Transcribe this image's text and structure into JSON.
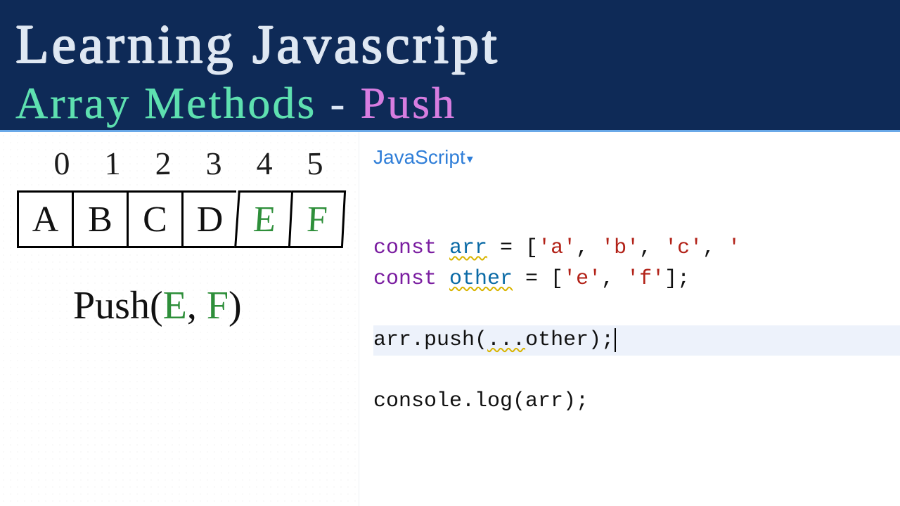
{
  "header": {
    "title": "Learning Javascript",
    "subtitle_a": "Array Methods",
    "subtitle_dash": " - ",
    "subtitle_b": "Push"
  },
  "diagram": {
    "indices": [
      "0",
      "1",
      "2",
      "3",
      "4",
      "5"
    ],
    "cells": [
      "A",
      "B",
      "C",
      "D",
      "E",
      "F"
    ],
    "push_label": "Push(",
    "push_arg1": "E",
    "push_comma": ", ",
    "push_arg2": "F",
    "push_close": ")"
  },
  "editor": {
    "lang": "JavaScript",
    "line1": {
      "kw": "const ",
      "ident": "arr",
      "rest1": " = [",
      "s1": "'a'",
      "c": ", ",
      "s2": "'b'",
      "s3": "'c'",
      "s4": "'",
      "tail_visible": ""
    },
    "line2": {
      "kw": "const ",
      "ident": "other",
      "rest1": " = [",
      "s1": "'e'",
      "c": ", ",
      "s2": "'f'",
      "close": "];"
    },
    "line4": {
      "obj": "arr",
      "call": ".push(",
      "spread": "...",
      "arg": "other",
      "close": ");"
    },
    "line6": {
      "text": "console.log(arr);"
    }
  }
}
